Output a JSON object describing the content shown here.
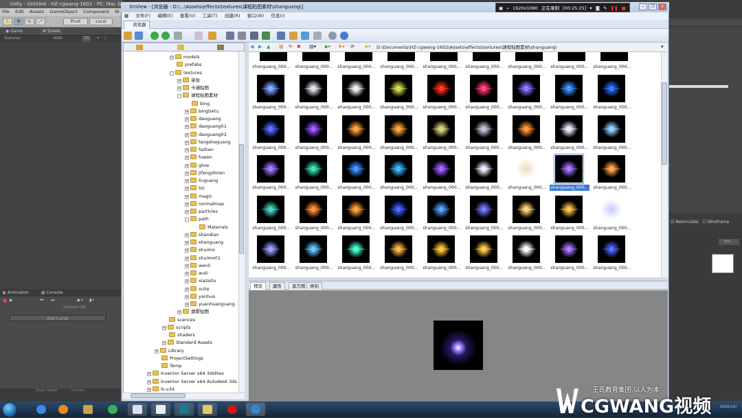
{
  "unity": {
    "title": "Unity - Untitled - HZ-cgwang-1602 - PC, Mac & L",
    "menu": [
      "File",
      "Edit",
      "Assets",
      "GameObject",
      "Component",
      "W"
    ],
    "toolbar": {
      "pivot": "Pivot",
      "local": "Local"
    },
    "view_tabs": {
      "game": "Game",
      "scene": "Scene"
    },
    "view_bar": {
      "textured": "Textured",
      "rgb": "RGB",
      "zoom": "2D"
    },
    "anim_tabs": {
      "animation": "Animation",
      "console": "Console"
    },
    "samples_label": "Samples",
    "samples_value": "60",
    "add_curve": "Add Curve",
    "bottom_tabs": {
      "dope_sheet": "Dope Sheet",
      "curves": "Curves"
    },
    "right_panel": {
      "resimulate": "Resimulate",
      "wireframe": "Wireframe",
      "edit": "Edit..."
    }
  },
  "xnview": {
    "title": "XnView - [浏览器 - D:\\...\\Assets\\effects\\textures\\课程贴图素材\\shanguang\\]",
    "menu": [
      "文件(F)",
      "编辑(E)",
      "查看(V)",
      "工具(T)",
      "创建(R)",
      "窗口(W)",
      "信息(I)"
    ],
    "tab": "浏览器",
    "address": "D:\\Documents\\HZ-cgwang-1602\\Assets\\effects\\textures\\课程贴图素材\\shanguang\\",
    "tree": [
      {
        "label": "models",
        "level": 3,
        "exp": "+"
      },
      {
        "label": "prefabs",
        "level": 3,
        "exp": ""
      },
      {
        "label": "textures",
        "level": 3,
        "exp": "-"
      },
      {
        "label": "单张",
        "level": 4,
        "exp": "+"
      },
      {
        "label": "卡通贴图",
        "level": 4,
        "exp": "+"
      },
      {
        "label": "课程贴图素材",
        "level": 4,
        "exp": "-"
      },
      {
        "label": "bing",
        "level": 5,
        "exp": ""
      },
      {
        "label": "bingtietu",
        "level": 5,
        "exp": "+"
      },
      {
        "label": "daoguang",
        "level": 5,
        "exp": "+"
      },
      {
        "label": "daoguang01",
        "level": 5,
        "exp": "+"
      },
      {
        "label": "daoguang02",
        "level": 5,
        "exp": "+"
      },
      {
        "label": "fangsheguang",
        "level": 5,
        "exp": "+"
      },
      {
        "label": "fazhen",
        "level": 5,
        "exp": "+"
      },
      {
        "label": "fuwen",
        "level": 5,
        "exp": "+"
      },
      {
        "label": "glow",
        "level": 5,
        "exp": "+"
      },
      {
        "label": "jifengzhiren",
        "level": 5,
        "exp": "+"
      },
      {
        "label": "liuguang",
        "level": 5,
        "exp": "+"
      },
      {
        "label": "lizi",
        "level": 5,
        "exp": "+"
      },
      {
        "label": "magic",
        "level": 5,
        "exp": "+"
      },
      {
        "label": "normalmap",
        "level": 5,
        "exp": "+"
      },
      {
        "label": "particles",
        "level": 5,
        "exp": "+"
      },
      {
        "label": "path",
        "level": 5,
        "exp": "-"
      },
      {
        "label": "Materials",
        "level": 6,
        "exp": ""
      },
      {
        "label": "shandian",
        "level": 5,
        "exp": "+"
      },
      {
        "label": "shanguang",
        "level": 5,
        "exp": "+"
      },
      {
        "label": "shuimo",
        "level": 5,
        "exp": "+"
      },
      {
        "label": "shuimo01",
        "level": 5,
        "exp": "+"
      },
      {
        "label": "wenli",
        "level": 5,
        "exp": "+"
      },
      {
        "label": "wuti",
        "level": 5,
        "exp": "+"
      },
      {
        "label": "xiazaitu",
        "level": 5,
        "exp": "+"
      },
      {
        "label": "xulie",
        "level": 5,
        "exp": "+"
      },
      {
        "label": "yanhuo",
        "level": 5,
        "exp": "+"
      },
      {
        "label": "yuanhuanguang",
        "level": 5,
        "exp": "+"
      },
      {
        "label": "烟雾贴图",
        "level": 4,
        "exp": "+"
      },
      {
        "label": "scences",
        "level": 2,
        "exp": ""
      },
      {
        "label": "scripts",
        "level": 2,
        "exp": "+"
      },
      {
        "label": "shaders",
        "level": 2,
        "exp": ""
      },
      {
        "label": "Standard Assets",
        "level": 2,
        "exp": "+"
      },
      {
        "label": "Library",
        "level": 1,
        "exp": "+"
      },
      {
        "label": "ProjectSettings",
        "level": 1,
        "exp": ""
      },
      {
        "label": "Temp",
        "level": 1,
        "exp": ""
      },
      {
        "label": "Inventor Server x64 3dsMax",
        "level": 0,
        "exp": "+"
      },
      {
        "label": "Inventor Server x64 Autodesk 3ds",
        "level": 0,
        "exp": "+"
      },
      {
        "label": "ls-u3d",
        "level": 0,
        "exp": "+"
      }
    ],
    "thumb_caption": "shanguang_000...",
    "selected_caption": "shanguang_000...",
    "thumbs": [
      [
        "#7aa0ff",
        "#dde",
        "#eee",
        "#cdd84a",
        "#ff2a1a",
        "#ff3a70",
        "#8a6cff",
        "#3c8cff",
        "#2a6aff"
      ],
      [
        "#4a66ff",
        "#9a4aff",
        "#ff9a3a",
        "#ffa030",
        "#d8d078",
        "#b8c0d0",
        "#ff9030",
        "#e8e8ff",
        "#8ad0ff"
      ],
      [
        "#a070ff",
        "#30e0b0",
        "#3a8aff",
        "#3ab0ff",
        "#9a5aff",
        "#e8e8ff",
        "light:#f0dcc0",
        "#a070ff",
        "#ffa040"
      ],
      [
        "#40d0c0",
        "#ff8a30",
        "#ff9a30",
        "#3a5aff",
        "#4a9aff",
        "#6a70ff",
        "#ffd070",
        "#ffc040",
        "light:#c8ccff"
      ],
      [
        "#8a9aff",
        "#60c0ff",
        "#3affd0",
        "#ffb040",
        "#ffc030",
        "#ffc840",
        "#ffffff",
        "#a070ff",
        "#4a60ff"
      ]
    ],
    "selected_index": [
      2,
      7
    ],
    "preview_tabs": [
      "预览",
      "属性",
      "直方图",
      "类别"
    ],
    "preview_color": "#a080ff"
  },
  "recording": {
    "resolution": "1920x1080",
    "status": "正在录制",
    "time": "[00:25:25]"
  },
  "watermark": {
    "top": "王氏教育集团,以人为本",
    "main": "CGWANG视频"
  },
  "taskbar": {
    "clock_time": "",
    "clock_date": "2016/12/"
  }
}
